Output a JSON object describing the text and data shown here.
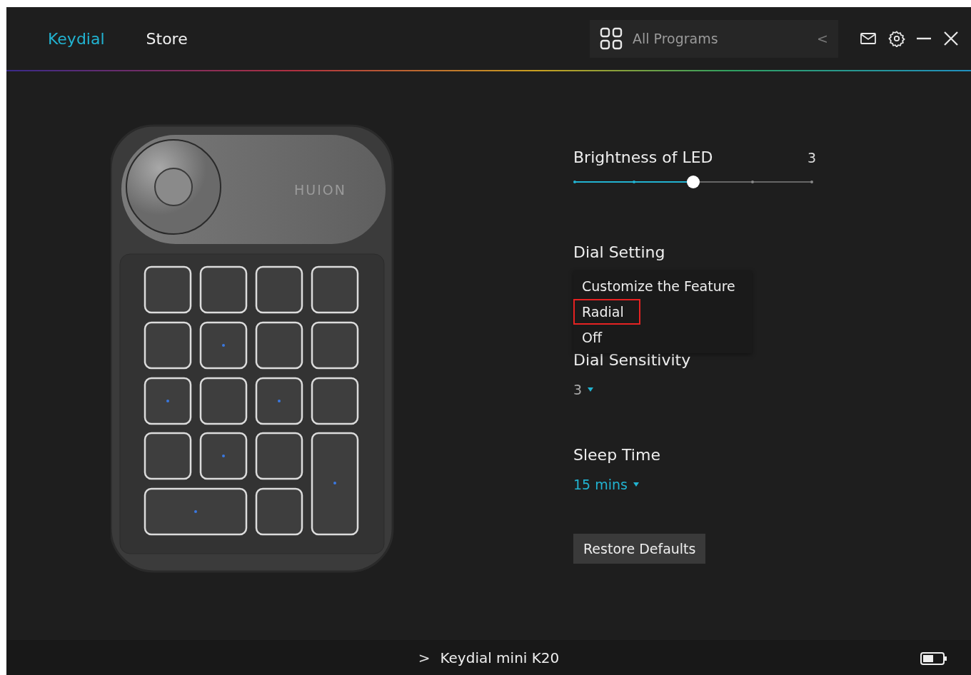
{
  "header": {
    "tabs": [
      {
        "label": "Keydial",
        "selected": true
      },
      {
        "label": "Store",
        "selected": false
      }
    ],
    "program_selector": {
      "value": "All Programs",
      "arrow": "<"
    }
  },
  "device": {
    "logo": "HUION"
  },
  "settings": {
    "brightness": {
      "title": "Brightness of LED",
      "reading": "3",
      "level": 0.5
    },
    "dial_setting": {
      "title": "Dial Setting",
      "options": [
        {
          "label": "Customize the Feature",
          "highlighted": false
        },
        {
          "label": "Radial",
          "highlighted": true
        },
        {
          "label": "Off",
          "highlighted": false
        }
      ]
    },
    "dial_sensitivity": {
      "title": "Dial Sensitivity",
      "value": "3"
    },
    "sleep_time": {
      "title": "Sleep Time",
      "value": "15 mins"
    },
    "restore_button": "Restore Defaults"
  },
  "status_bar": {
    "chevron": ">",
    "device_name": "Keydial mini K20"
  }
}
